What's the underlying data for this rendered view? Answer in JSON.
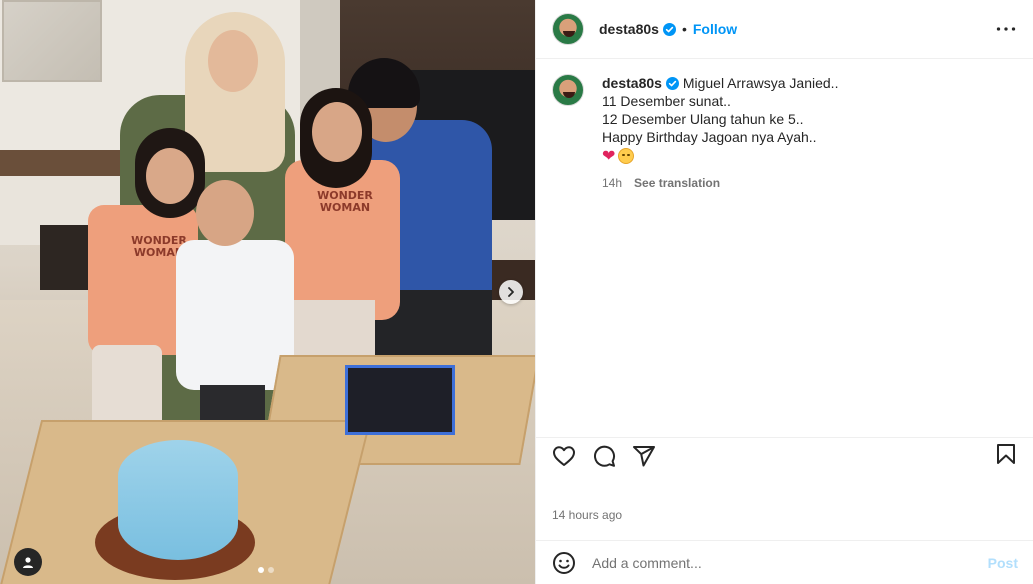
{
  "post": {
    "username": "desta80s",
    "follow_label": "Follow",
    "separator": "•"
  },
  "caption": {
    "username": "desta80s",
    "lines": [
      "Miguel Arrawsya Janied..",
      "11 Desember sunat..",
      "12 Desember Ulang tahun ke 5..",
      "Happy Birthday Jagoan nya Ayah.."
    ],
    "emojis": [
      "heart",
      "smiling-face"
    ],
    "age": "14h",
    "see_translation": "See translation"
  },
  "media": {
    "shirt_text": "WONDER WOMAN",
    "carousel": {
      "count": 2,
      "active_index": 0
    }
  },
  "footer": {
    "time_ago": "14 hours ago",
    "comment_placeholder": "Add a comment...",
    "post_label": "Post"
  },
  "colors": {
    "accent": "#0095f6",
    "post_disabled": "#b2dffc",
    "text": "#262626",
    "muted": "#737373",
    "verified": "#0095f6",
    "heart": "#e0245e"
  },
  "icons": [
    "verified-badge-icon",
    "more-options-icon",
    "chevron-right-icon",
    "user-tag-icon",
    "heart-icon",
    "comment-icon",
    "share-icon",
    "bookmark-icon",
    "emoji-icon"
  ]
}
